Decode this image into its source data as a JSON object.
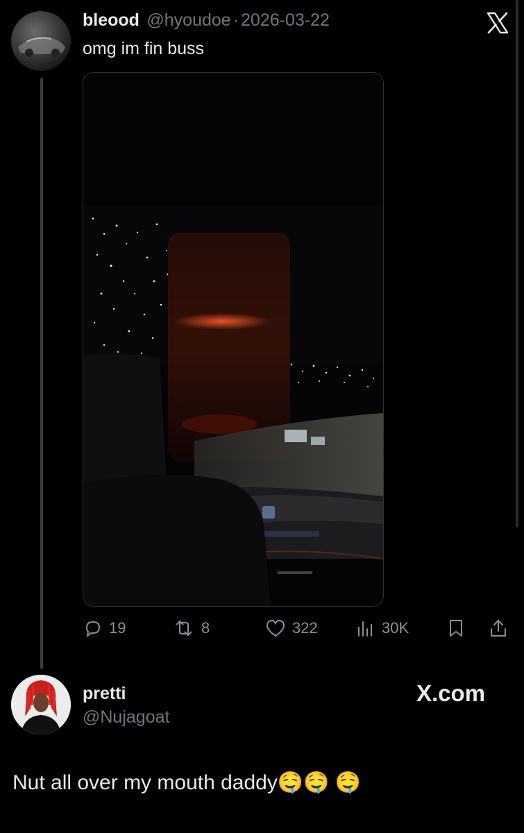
{
  "tweet": {
    "author_name": "bleood",
    "author_handle": "@hyoudoe",
    "separator": "·",
    "date": "2026-03-22",
    "text": "omg im fin buss",
    "close_icon": "x-logo-icon",
    "stats": {
      "replies": "19",
      "reposts": "8",
      "likes": "322",
      "views": "30K"
    }
  },
  "reply": {
    "author_name": "pretti",
    "author_handle": "@Nujagoat",
    "brand": "X.com",
    "text": "Nut all over my mouth daddy🤤🤤 🤤"
  },
  "colors": {
    "background": "#000000",
    "text_primary": "#e7e9ea",
    "text_secondary": "#71767b",
    "border": "#2f3336",
    "hair_red": "#c8201d"
  }
}
